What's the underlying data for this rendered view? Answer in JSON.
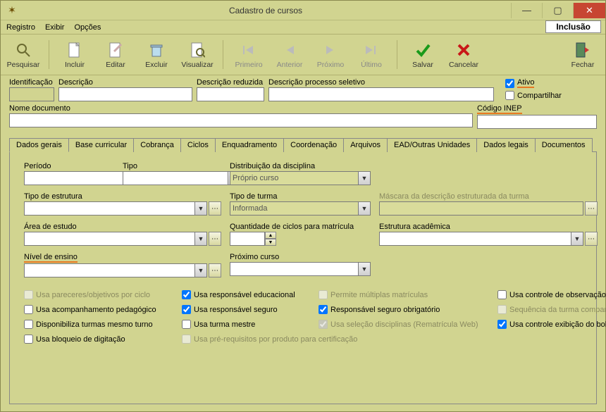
{
  "window": {
    "title": "Cadastro de cursos",
    "mode_badge": "Inclusão"
  },
  "menu": {
    "registro": "Registro",
    "exibir": "Exibir",
    "opcoes": "Opções"
  },
  "toolbar": {
    "pesquisar": "Pesquisar",
    "incluir": "Incluir",
    "editar": "Editar",
    "excluir": "Excluir",
    "visualizar": "Visualizar",
    "primeiro": "Primeiro",
    "anterior": "Anterior",
    "proximo": "Próximo",
    "ultimo": "Último",
    "salvar": "Salvar",
    "cancelar": "Cancelar",
    "fechar": "Fechar"
  },
  "header": {
    "identificacao_label": "Identificação",
    "identificacao": "",
    "descricao_label": "Descrição",
    "descricao": "",
    "descricao_reduzida_label": "Descrição reduzida",
    "descricao_reduzida": "",
    "descricao_proc_sel_label": "Descrição processo seletivo",
    "descricao_proc_sel": "",
    "ativo_label": "Ativo",
    "ativo_checked": true,
    "compartilhar_label": "Compartilhar",
    "compartilhar_checked": false,
    "nome_documento_label": "Nome documento",
    "nome_documento": "",
    "codigo_inep_label": "Código INEP",
    "codigo_inep": ""
  },
  "tabs": {
    "dados_gerais": "Dados gerais",
    "base_curricular": "Base curricular",
    "cobranca": "Cobrança",
    "ciclos": "Ciclos",
    "enquadramento": "Enquadramento",
    "coordenacao": "Coordenação",
    "arquivos": "Arquivos",
    "ead": "EAD/Outras Unidades",
    "dados_legais": "Dados legais",
    "documentos": "Documentos"
  },
  "panel": {
    "periodo_label": "Período",
    "periodo": "",
    "tipo_label": "Tipo",
    "tipo": "",
    "dist_label": "Distribuição da disciplina",
    "dist": "Próprio curso",
    "tipo_estrutura_label": "Tipo de estrutura",
    "tipo_estrutura": "",
    "tipo_turma_label": "Tipo de turma",
    "tipo_turma": "Informada",
    "mascara_label": "Máscara da descrição estruturada da turma",
    "mascara": "",
    "area_estudo_label": "Área de estudo",
    "area_estudo": "",
    "qtd_ciclos_label": "Quantidade de ciclos para matrícula",
    "qtd_ciclos": "",
    "estrutura_acad_label": "Estrutura acadêmica",
    "estrutura_acad": "",
    "nivel_ensino_label": "Nível de ensino",
    "nivel_ensino": "",
    "proximo_curso_label": "Próximo curso",
    "proximo_curso": ""
  },
  "checks": {
    "c_usa_pareceres": "Usa pareceres/objetivos por ciclo",
    "c_resp_educ": "Usa responsável educacional",
    "c_permite_mult": "Permite múltiplas matrículas",
    "c_controle_obs": "Usa controle de observação no diário",
    "c_acomp_ped": "Usa acompanhamento pedagógico",
    "c_resp_seguro": "Usa responsável seguro",
    "c_resp_seg_obrig": "Responsável seguro obrigatório",
    "c_seq_turma": "Sequência da turma compartilhada",
    "c_disp_turmas": "Disponibiliza turmas mesmo turno",
    "c_turma_mestre": "Usa turma mestre",
    "c_sel_disc": "Usa seleção disciplinas (Rematrícula Web)",
    "c_exib_boletim": "Usa controle exibição do boletim web",
    "c_bloqueio": "Usa bloqueio de digitação",
    "c_pre_req": "Usa pré-requisitos por produto para certificação"
  }
}
